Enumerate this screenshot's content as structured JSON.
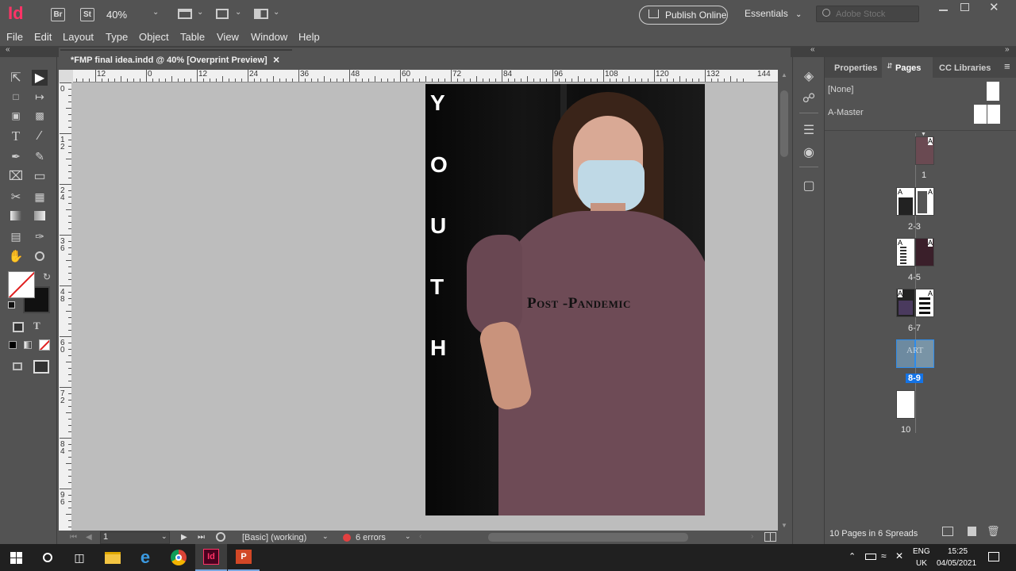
{
  "app": {
    "logo": "Id",
    "bridge": "Br",
    "stock": "St",
    "zoom": "40%",
    "publish_label": "Publish Online",
    "workspace": "Essentials",
    "search_placeholder": "Adobe Stock"
  },
  "menu": [
    "File",
    "Edit",
    "Layout",
    "Type",
    "Object",
    "Table",
    "View",
    "Window",
    "Help"
  ],
  "document": {
    "tab_title": "*FMP final idea.indd @ 40% [Overprint Preview]",
    "close": "×"
  },
  "ruler_h": [
    "12",
    "0",
    "12",
    "24",
    "36",
    "48",
    "60",
    "72",
    "84",
    "96",
    "108",
    "120",
    "132",
    "144"
  ],
  "ruler_v": [
    "0",
    "1\n2",
    "2\n4",
    "3\n6",
    "4\n8",
    "6\n0",
    "7\n2",
    "8\n4",
    "9\n6"
  ],
  "page": {
    "youth_letters": [
      "Y",
      "O",
      "U",
      "T",
      "H"
    ],
    "headline": "Post -Pandemic"
  },
  "status": {
    "page_number": "1",
    "preflight_profile": "[Basic] (working)",
    "errors": "6 errors",
    "error_color": "#e34040"
  },
  "panel": {
    "tabs": [
      "Properties",
      "Pages",
      "CC Libraries"
    ],
    "active_tab": "Pages",
    "masters": [
      "[None]",
      "A-Master"
    ],
    "spreads": [
      {
        "label": "1",
        "selected": false
      },
      {
        "label": "2-3",
        "selected": false
      },
      {
        "label": "4-5",
        "selected": false
      },
      {
        "label": "6-7",
        "selected": false
      },
      {
        "label": "8-9",
        "selected": true
      },
      {
        "label": "10",
        "selected": false
      }
    ],
    "thumb_text": {
      "master_marker": "A",
      "art": "ART"
    },
    "footer": "10 Pages in 6 Spreads"
  },
  "taskbar": {
    "lang": "ENG",
    "region": "UK",
    "time": "15:25",
    "date": "04/05/2021"
  },
  "colors": {
    "indesign": "#ff3366",
    "accent": "#2d8ceb",
    "selected_page": "#1473e6"
  }
}
